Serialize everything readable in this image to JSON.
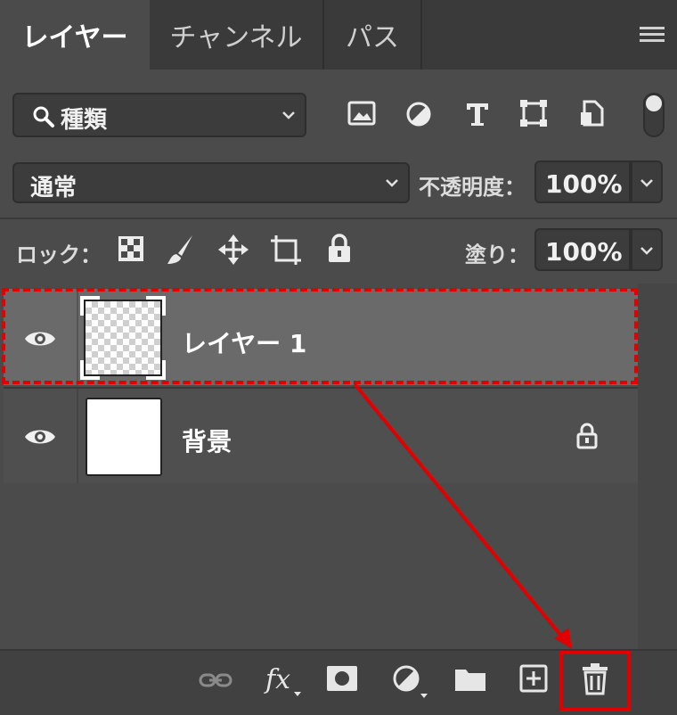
{
  "tabs": [
    {
      "label": "レイヤー",
      "active": true
    },
    {
      "label": "チャンネル",
      "active": false
    },
    {
      "label": "パス",
      "active": false
    }
  ],
  "filter": {
    "label": "種類"
  },
  "blend": {
    "mode": "通常",
    "opacity_label": "不透明度：",
    "opacity_value": "100%"
  },
  "lock": {
    "label": "ロック：",
    "fill_label": "塗り：",
    "fill_value": "100%"
  },
  "layers": [
    {
      "name": "レイヤー 1",
      "selected": true,
      "locked": false
    },
    {
      "name": "背景",
      "selected": false,
      "locked": true
    }
  ],
  "colors": {
    "panel_bg": "#4b4b4b",
    "selected_row": "#6a6a6a",
    "annotation_red": "#e00000"
  }
}
